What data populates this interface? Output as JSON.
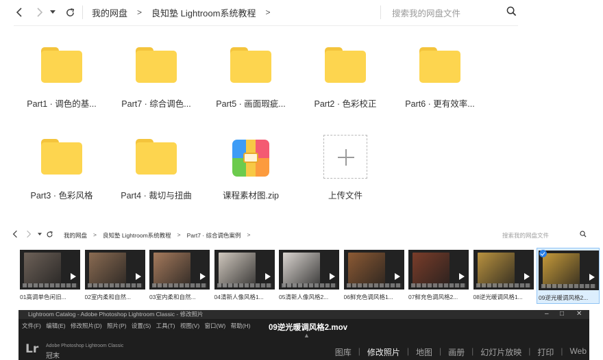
{
  "nav": {
    "breadcrumbs": [
      "我的网盘",
      "良知塾 Lightroom系统教程"
    ],
    "trail_separator": ">",
    "search_placeholder": "搜索我的网盘文件"
  },
  "items": [
    {
      "type": "folder",
      "label": "Part1 · 调色的基..."
    },
    {
      "type": "folder",
      "label": "Part7 · 综合调色..."
    },
    {
      "type": "folder",
      "label": "Part5 · 画面瑕疵..."
    },
    {
      "type": "folder",
      "label": "Part2 · 色彩校正"
    },
    {
      "type": "folder",
      "label": "Part6 · 更有效率..."
    },
    {
      "type": "folder",
      "label": "Part3 · 色彩风格"
    },
    {
      "type": "folder",
      "label": "Part4 · 裁切与扭曲"
    },
    {
      "type": "zip",
      "label": "课程素材图.zip"
    },
    {
      "type": "upload",
      "label": "上传文件"
    }
  ],
  "inner_window": {
    "breadcrumbs": [
      "我的网盘",
      "良知塾 Lightroom系统教程",
      "Part7 · 综合调色案例"
    ],
    "trail_separator": ">",
    "search_placeholder": "搜索我的网盘文件",
    "videos": [
      {
        "name": "01高调单色闲旧...",
        "tone": "#6d6158",
        "selected": false
      },
      {
        "name": "02室内柔和自然...",
        "tone": "#8a6b52",
        "selected": false
      },
      {
        "name": "03室内柔和自然...",
        "tone": "#a57a5c",
        "selected": false
      },
      {
        "name": "04清新人像风格1...",
        "tone": "#cfc7bd",
        "selected": false
      },
      {
        "name": "05清新人像风格2...",
        "tone": "#d9d4cf",
        "selected": false
      },
      {
        "name": "06鲜充色调风格1...",
        "tone": "#8c5a34",
        "selected": false
      },
      {
        "name": "07鲜充色调风格2...",
        "tone": "#7a3d2a",
        "selected": false
      },
      {
        "name": "08逆光暖调风格1...",
        "tone": "#b9923f",
        "selected": false
      },
      {
        "name": "09逆光暖调风格2...",
        "tone": "#c69a3a",
        "selected": true
      }
    ]
  },
  "lightroom": {
    "title": "Lightroom Catalog - Adobe Photoshop Lightroom Classic - 修改照片",
    "menu": [
      "文件(F)",
      "编辑(E)",
      "修改照片(D)",
      "照片(P)",
      "设置(S)",
      "工具(T)",
      "视图(V)",
      "窗口(W)",
      "帮助(H)"
    ],
    "window_buttons": [
      "–",
      "□",
      "✕"
    ],
    "overlay_filename": "09逆光暖调风格2.mov",
    "logo": "Lr",
    "product": "Adobe Photoshop Lightroom Classic",
    "user": "冠末",
    "modules": [
      "图库",
      "修改照片",
      "地图",
      "画册",
      "幻灯片放映",
      "打印",
      "Web"
    ],
    "active_module": "修改照片"
  }
}
